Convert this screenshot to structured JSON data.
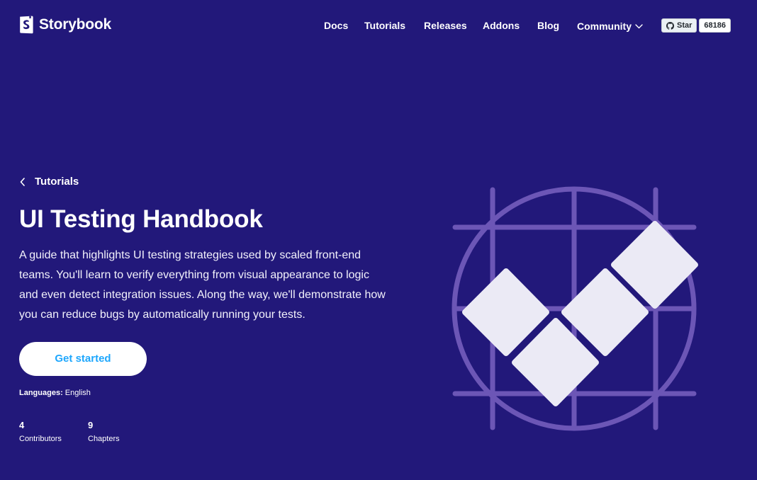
{
  "header": {
    "logo_text": "Storybook",
    "nav": [
      {
        "label": "Docs"
      },
      {
        "label": "Tutorials"
      },
      {
        "label": "Releases"
      },
      {
        "label": "Addons"
      },
      {
        "label": "Blog"
      },
      {
        "label": "Community",
        "icon": "chevron-down-icon"
      }
    ],
    "github": {
      "icon": "github-icon",
      "star_label": "Star",
      "star_count": "68186"
    }
  },
  "hero": {
    "back_label": "Tutorials",
    "title": "UI Testing Handbook",
    "description": "A guide that highlights UI testing strategies used by scaled front-end teams. You'll learn to verify everything from visual appearance to logic and even detect integration issues. Along the way, we'll demonstrate how you can reduce bugs by automatically running your tests.",
    "cta_label": "Get started",
    "languages_label": "Languages:",
    "languages_value": "English",
    "stats": [
      {
        "value": "4",
        "label": "Contributors"
      },
      {
        "value": "9",
        "label": "Chapters"
      }
    ],
    "illustration": "grid-circle-checkmark-illustration"
  },
  "colors": {
    "background": "#22187a",
    "accent": "#1ea7fd",
    "illustration_lines": "#6c56b6",
    "illustration_tiles": "#ebeaf5"
  }
}
